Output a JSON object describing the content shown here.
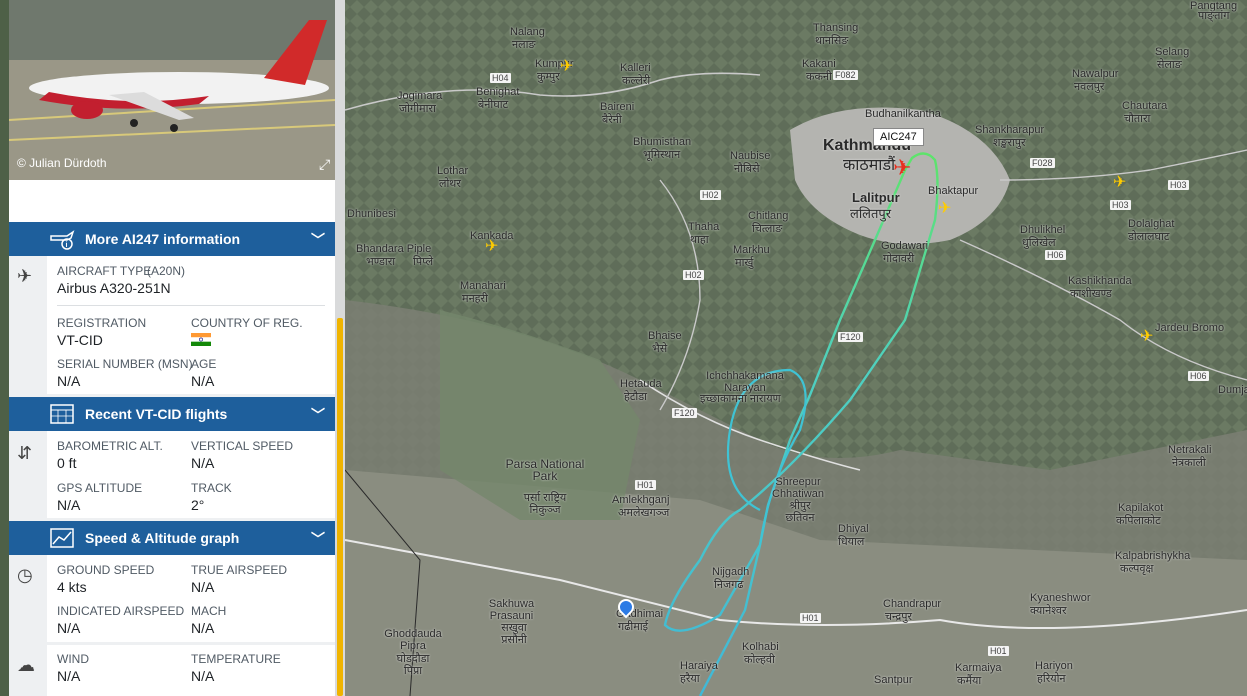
{
  "photo": {
    "credit": "© Julian Dürdoth"
  },
  "sections": {
    "more_info": {
      "title": "More AI247 information"
    },
    "recent_flights": {
      "title": "Recent VT-CID flights"
    },
    "speed_graph": {
      "title": "Speed & Altitude graph"
    }
  },
  "aircraft": {
    "type_label": "AIRCRAFT TYPE",
    "type_code": "(A20N)",
    "type_value": "Airbus A320-251N",
    "registration_label": "REGISTRATION",
    "registration_value": "VT-CID",
    "country_label": "COUNTRY OF REG.",
    "serial_label": "SERIAL NUMBER (MSN)",
    "serial_value": "N/A",
    "age_label": "AGE",
    "age_value": "N/A"
  },
  "altitude": {
    "baro_label": "BAROMETRIC ALT.",
    "baro_value": "0 ft",
    "vspeed_label": "VERTICAL SPEED",
    "vspeed_value": "N/A",
    "gps_label": "GPS ALTITUDE",
    "gps_value": "N/A",
    "track_label": "TRACK",
    "track_value": "2°"
  },
  "speed": {
    "gs_label": "GROUND SPEED",
    "gs_value": "4 kts",
    "tas_label": "TRUE AIRSPEED",
    "tas_value": "N/A",
    "ias_label": "INDICATED AIRSPEED",
    "ias_value": "N/A",
    "mach_label": "MACH",
    "mach_value": "N/A"
  },
  "weather": {
    "wind_label": "WIND",
    "wind_value": "N/A",
    "temp_label": "TEMPERATURE",
    "temp_value": "N/A"
  },
  "map": {
    "callsign": "AIC247",
    "places": [
      "Kathmandu",
      "काठमाडौं",
      "Lalitpur",
      "ललितपुर",
      "Bhaktapur",
      "Budhanilkantha",
      "Thansing",
      "थानसिङ",
      "Kakani",
      "ककनी",
      "Nalang",
      "नलाङ",
      "Kumpur",
      "कुम्पुर",
      "Kalleri",
      "कल्लेरी",
      "Benighat",
      "बेनीघाट",
      "Jogimara",
      "जोगीमारा",
      "Baireni",
      "बैरेनी",
      "Bhumisthan",
      "भूमिस्थान",
      "Naubise",
      "नौबिसे",
      "Thaha",
      "थाहा",
      "Chitlang",
      "चित्लाङ",
      "Markhu",
      "मार्खु",
      "Godawari",
      "गोदावरी",
      "Shankharapur",
      "शङ्खरापुर",
      "Dhulikhel",
      "धुलिखेल",
      "Dolalghat",
      "डोलालघाट",
      "Kashikhanda",
      "काशीखण्ड",
      "Jardeu Bromo",
      "Nawalpur",
      "नवलपुर",
      "Chautara",
      "चौतारा",
      "Selang",
      "सेलाङ",
      "Pangtang",
      "पाङ्तांग",
      "Lothar",
      "लोथर",
      "Kankada",
      "Manahari",
      "मनहरी",
      "Bhandara Piple",
      "भण्डारा",
      "पिप्ले",
      "Dhunibesi",
      "Bhaise",
      "भैसे",
      "Hetauda",
      "हेटौडा",
      "Ichchhakamana Narayan",
      "इच्छाकामना नारायण",
      "Parsa National Park",
      "पर्सा राष्ट्रिय निकुञ्ज",
      "Amlekhganj",
      "अमलेखगञ्ज",
      "Shreepur Chhatiwan",
      "श्रीपुर छतिवन",
      "Dhiyal",
      "धियाल",
      "Nijgadh",
      "निजगढ",
      "Sakhuwa Prasauni",
      "सखुवा प्रसौनी",
      "Gadhimai",
      "गढीमाई",
      "Ghoddauda Pipra",
      "घोडदौडा पिप्रा",
      "Kolhabi",
      "कोल्हवी",
      "Haraiya",
      "हरैया",
      "Chandrapur",
      "चन्द्रपुर",
      "Kyaneshwor",
      "क्यानेश्वर",
      "Kalpabrishykha",
      "कल्पवृक्ष",
      "Kapilakot",
      "कपिलाकोट",
      "Netrakali",
      "नेत्रकाली",
      "Karmaiya",
      "कर्मैया",
      "Hariyon",
      "हरियोन",
      "Santpur",
      "Dumja"
    ],
    "roads": [
      "H04",
      "F082",
      "F028",
      "H03",
      "H02",
      "H06",
      "H02",
      "F120",
      "F120",
      "H01",
      "H01",
      "H01",
      "H03",
      "H06"
    ]
  }
}
